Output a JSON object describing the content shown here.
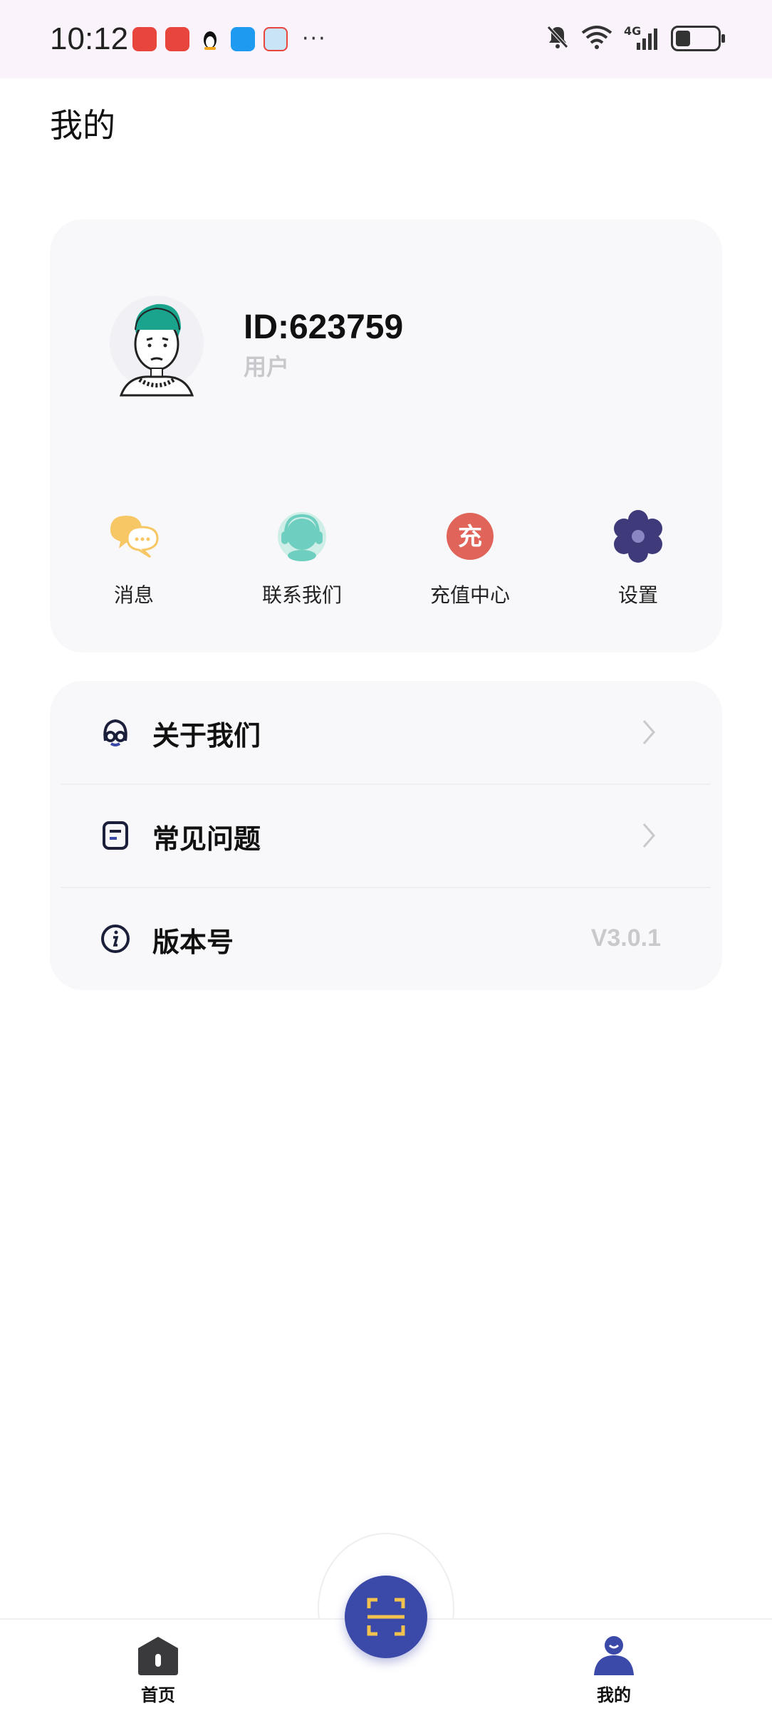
{
  "status_bar": {
    "time": "10:12",
    "network": "4G",
    "notif_apps": [
      "phone-app-icon",
      "huawei-app-icon",
      "qq-app-icon",
      "message-app-icon",
      "game-app-icon"
    ],
    "more": "···"
  },
  "page": {
    "title": "我的"
  },
  "profile": {
    "id_text": "ID:623759",
    "role": "用户"
  },
  "quick_actions": [
    {
      "label": "消息",
      "icon": "message-bubbles-icon",
      "color": "#f7c766"
    },
    {
      "label": "联系我们",
      "icon": "customer-service-icon",
      "color": "#6ecfc0"
    },
    {
      "label": "充值中心",
      "icon": "recharge-icon",
      "color": "#e0645a",
      "glyph": "充"
    },
    {
      "label": "设置",
      "icon": "settings-flower-icon",
      "color": "#3f3a7a"
    }
  ],
  "menu": {
    "about": {
      "label": "关于我们",
      "icon": "about-us-icon"
    },
    "faq": {
      "label": "常见问题",
      "icon": "faq-document-icon"
    },
    "version": {
      "label": "版本号",
      "icon": "info-icon",
      "value": "V3.0.1"
    }
  },
  "bottom_nav": {
    "home": {
      "label": "首页",
      "icon": "home-icon"
    },
    "scan": {
      "icon": "scan-icon",
      "color": "#3b49a8"
    },
    "mine": {
      "label": "我的",
      "icon": "user-icon",
      "color": "#3b49a8"
    }
  }
}
